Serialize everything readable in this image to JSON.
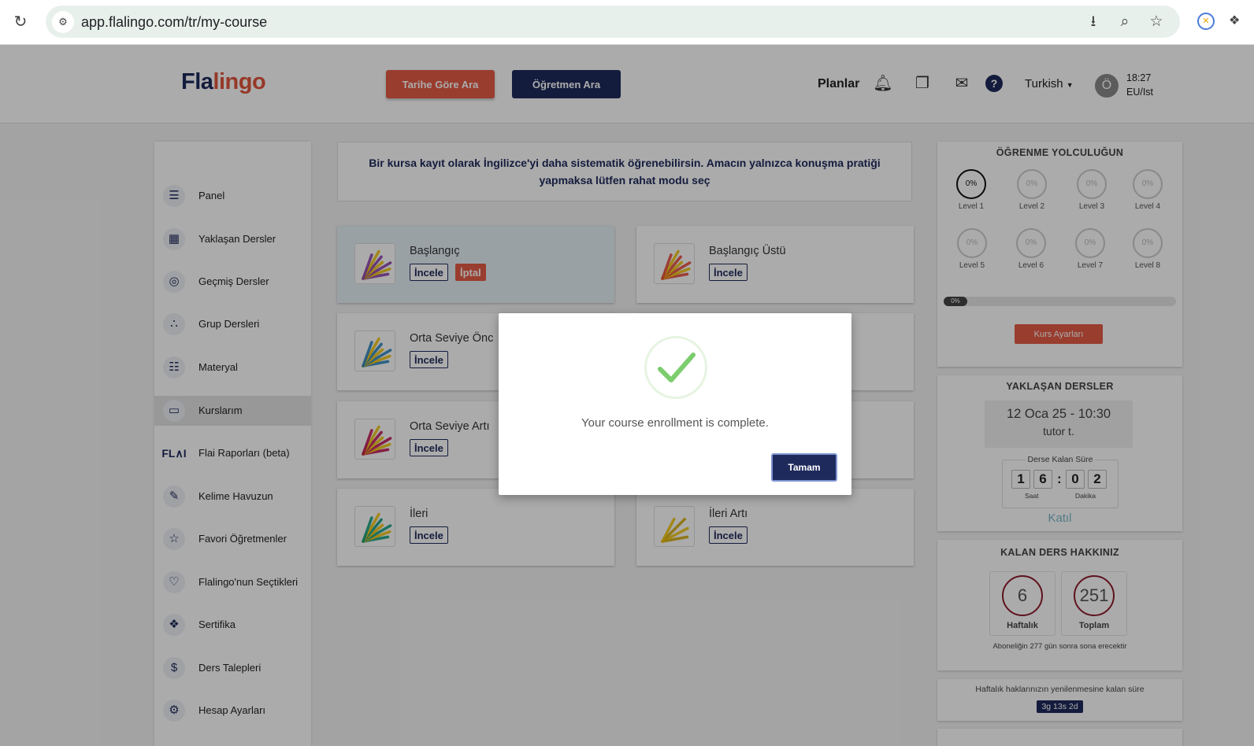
{
  "browser": {
    "url": "app.flalingo.com/tr/my-course"
  },
  "header": {
    "logo_part1": "Fla",
    "logo_part2": "lingo",
    "search_by_date": "Tarihe Göre Ara",
    "search_teacher": "Öğretmen Ara",
    "plans": "Planlar",
    "language": "Turkish",
    "avatar_initial": "Ö",
    "time": "18:27",
    "timezone": "EU/Ist"
  },
  "sidebar": {
    "items": [
      {
        "label": "Panel",
        "icon": "notebook-icon"
      },
      {
        "label": "Yaklaşan Dersler",
        "icon": "calendar-screen-icon"
      },
      {
        "label": "Geçmiş Dersler",
        "icon": "globe-clock-icon"
      },
      {
        "label": "Grup Dersleri",
        "icon": "group-circles-icon"
      },
      {
        "label": "Materyal",
        "icon": "document-icon"
      },
      {
        "label": "Kurslarım",
        "icon": "monitor-icon"
      },
      {
        "label": "Flai Raporları (beta)",
        "icon": "flai-logo-icon",
        "icon_text": "FL∧I"
      },
      {
        "label": "Kelime Havuzun",
        "icon": "word-pool-icon"
      },
      {
        "label": "Favori Öğretmenler",
        "icon": "star-badge-icon"
      },
      {
        "label": "Flalingo'nun Seçtikleri",
        "icon": "people-heart-icon"
      },
      {
        "label": "Sertifika",
        "icon": "certificate-icon"
      },
      {
        "label": "Ders Talepleri",
        "icon": "money-exchange-icon"
      },
      {
        "label": "Hesap Ayarları",
        "icon": "gear-icon"
      }
    ]
  },
  "main": {
    "info_text": "Bir kursa kayıt olarak İngilizce'yi daha sistematik öğrenebilirsin. Amacın yalnızca konuşma pratiği yapmaksa lütfen rahat modu seç",
    "courses": [
      {
        "title": "Başlangıç",
        "inspect": "İncele",
        "cancel": "İptal",
        "color": "#8e44ad"
      },
      {
        "title": "Başlangıç Üstü",
        "inspect": "İncele",
        "color": "#e74c3c"
      },
      {
        "title": "Orta Seviye Önc",
        "inspect": "İncele",
        "color": "#2e86c1"
      },
      {
        "title": "Orta Seviye Artı",
        "inspect": "İncele",
        "color": "#c2185b"
      },
      {
        "title": "İleri",
        "inspect": "İncele",
        "color": "#16a085"
      },
      {
        "title": "İleri Artı",
        "inspect": "İncele",
        "color": "#d4ac0d"
      }
    ]
  },
  "journey": {
    "title": "ÖĞRENME YOLCULUĞUN",
    "levels": [
      {
        "label": "Level 1",
        "percent": "0%"
      },
      {
        "label": "Level 2",
        "percent": "0%"
      },
      {
        "label": "Level 3",
        "percent": "0%"
      },
      {
        "label": "Level 4",
        "percent": "0%"
      },
      {
        "label": "Level 5",
        "percent": "0%"
      },
      {
        "label": "Level 6",
        "percent": "0%"
      },
      {
        "label": "Level 7",
        "percent": "0%"
      },
      {
        "label": "Level 8",
        "percent": "0%"
      }
    ],
    "progress": "0%",
    "settings_button": "Kurs Ayarları"
  },
  "upcoming": {
    "title": "YAKLAŞAN DERSLER",
    "date": "12 Oca 25 - 10:30",
    "tutor": "tutor t.",
    "countdown_title": "Derse Kalan Süre",
    "digits": [
      "1",
      "6",
      "0",
      "2"
    ],
    "separator": ":",
    "hours_label": "Saat",
    "minutes_label": "Dakika",
    "join": "Katıl"
  },
  "credits": {
    "title": "KALAN DERS HAKKINIZ",
    "weekly_value": "6",
    "weekly_label": "Haftalık",
    "total_value": "251",
    "total_label": "Toplam",
    "subscription_text": "Aboneliğin 277 gün sonra sona erecektir"
  },
  "renewal": {
    "text": "Haftalık haklarınızın yenilenmesine kalan süre",
    "badge": "3g 13s 2d"
  },
  "modal": {
    "message": "Your course enrollment is complete.",
    "ok_button": "Tamam"
  },
  "colors": {
    "navy": "#1f2a5c",
    "accent_red": "#e55b45",
    "success_green": "#7ccd6d"
  }
}
